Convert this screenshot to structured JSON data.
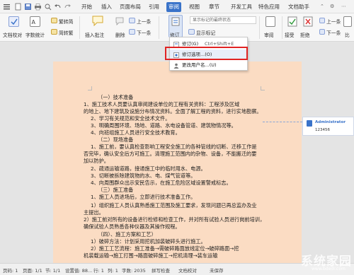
{
  "tabs": [
    "开始",
    "插入",
    "页面布局",
    "引用",
    "审阅",
    "视图",
    "章节",
    "开发工具",
    "特色应用",
    "文档助手"
  ],
  "active_tab": "审阅",
  "ribbon": {
    "doc_proof": "文档校对",
    "word_count": "字数统计",
    "trad": "繁转简",
    "simp": "简转繁",
    "new_comment": "插入批注",
    "delete": "删除",
    "prev_top": "上一条",
    "next_top": "下一条",
    "track": "修订",
    "markup_combo": "显示标记的最终状态",
    "show_markup": "显示标记",
    "review_pane": "审阅",
    "accept": "接受",
    "reject": "拒绝",
    "prev_right": "上一条",
    "next_right": "下一条",
    "compare": "比"
  },
  "menu": {
    "item1": "修订(G)",
    "item1_shortcut": "Ctrl+Shift+E",
    "item2": "修订选项...(O)",
    "item3": "更改用户名...(U)"
  },
  "balloon": {
    "author": "Administrator",
    "text": "123456"
  },
  "doc_lines": [
    "（一）技术准备",
    "1、施工技术人员要认真审阅建设单位的工程有关资料：工程涉及区域",
    "的地上、地下建筑及设施分布情况资料。全面了解工程的资料，进行实地勘察。",
    "2、学习有关规范和安全技术文件。",
    "3、明确周围环境、场地、道路、水电设备管道、建筑物情况等。",
    "4、向班组施工人员进行安全技术教育。",
    "（二）现场准备",
    "1、施工前，要认真检查影响工程安全施工的各种管线的切断、迁移工作是",
    "否完毕，确认安全后方可施工。清理施工范围内的杂物、设备，不能搬迁的要",
    "加以防护。",
    "2、疏通运输道路，接通施工中的临时用水、电源。",
    "3、切断被拆除建筑物的水、电、煤气管道等。",
    "4、向周围群众出示安民告示，在施工危险区域设置警戒标志。",
    "（三）施工准备",
    "1、施工人员进场后，立即进行技术准备工作。",
    "1）组织施工人员认真熟悉施工范围及施工要求，发现问题已再总监办及业",
    "主提出。",
    "2）施工前对所有的设备进行检修和检查工作，并对所有试验人员进行岗前培训，",
    "确保试验人员熟悉各种仪器及其操作规程。",
    "（四）、施工方案和工艺）",
    "1）破碎方法：计划采用挖机加装破碎头进行施工。",
    "2）施工工艺流程：施工准备→需破碎路面放线定位→破碎路面→挖",
    "机装载运输→施工打围→路面破碎施工→挖机清理→装车运输"
  ],
  "status": {
    "page": "页码: 1",
    "pages": "页面: 1/1",
    "section": "节: 1/1",
    "settings": "设置值: 88...",
    "row": "行: 1",
    "col": "列: 1",
    "words": "字数: 2035",
    "spell": "拼写检查",
    "proof": "文档校对",
    "unsaved": "未保存"
  },
  "watermark": {
    "text": "系统家园",
    "url": "www.bdedr.com"
  }
}
